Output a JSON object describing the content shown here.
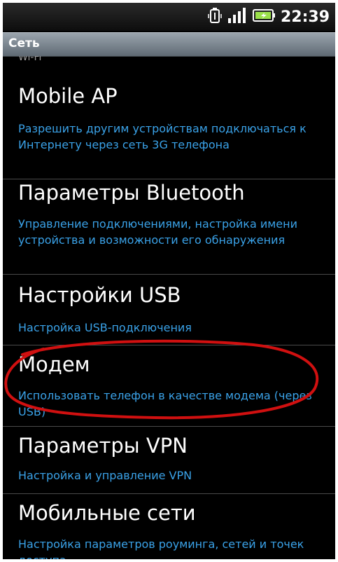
{
  "status_bar": {
    "time": "22:39",
    "icons": [
      "usb-icon",
      "signal-icon",
      "battery-icon"
    ]
  },
  "header": {
    "title": "Сеть"
  },
  "list": {
    "partial_item": "Wi-Fi",
    "items": [
      {
        "title": "Mobile AP",
        "subtitle": "Разрешить другим устройствам подключаться к Интернету через сеть 3G телефона"
      },
      {
        "title": "Параметры Bluetooth",
        "subtitle": "Управление подключениями, настройка имени устройства и возможности его обнаружения"
      },
      {
        "title": "Настройки USB",
        "subtitle": "Настройка USB-подключения"
      },
      {
        "title": "Модем",
        "subtitle": "Использовать телефон в качестве модема (через USB)"
      },
      {
        "title": "Параметры VPN",
        "subtitle": "Настройка и управление VPN"
      },
      {
        "title": "Мобильные сети",
        "subtitle": "Настройка параметров роуминга, сетей и точек доступа"
      }
    ]
  },
  "colors": {
    "title_bar": "#7a848d",
    "subtitle": "#3aa2e8",
    "highlight_circle": "#d01010"
  }
}
